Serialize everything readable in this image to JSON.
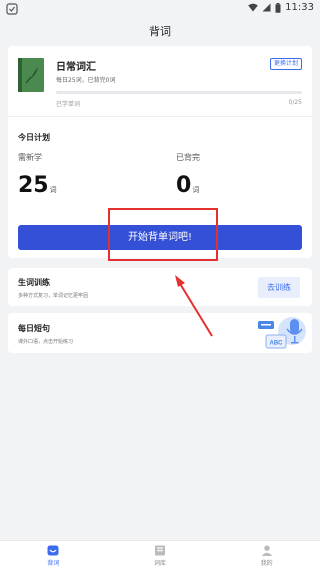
{
  "status_bar": {
    "time": "11:33"
  },
  "header": {
    "title": "背词"
  },
  "book": {
    "name": "日常词汇",
    "subtitle": "每日25词，已背完0词",
    "change_plan_label": "更换计划",
    "learned_label": "已学单词",
    "learned_count": "0/25",
    "progress": 0
  },
  "plan": {
    "title": "今日计划",
    "need_label": "需新学",
    "need_value": "25",
    "need_unit": "词",
    "done_label": "已背完",
    "done_value": "0",
    "done_unit": "词",
    "start_button": "开始背单词吧!"
  },
  "training": {
    "title": "生词训练",
    "subtitle": "多种方式复习，单词记忆更牢固",
    "button": "去训练"
  },
  "daily": {
    "title": "每日短句",
    "subtitle": "课外口语，点击开始练习",
    "illustration_text": "ABC"
  },
  "tabs": [
    {
      "label": "背词",
      "icon": "smile-icon",
      "active": true
    },
    {
      "label": "词库",
      "icon": "book-icon",
      "active": false
    },
    {
      "label": "我的",
      "icon": "user-icon",
      "active": false
    }
  ],
  "colors": {
    "accent": "#3450d6",
    "link": "#3b6cf0",
    "annotation": "#e53030",
    "book_cover": "#4a8a4e"
  }
}
